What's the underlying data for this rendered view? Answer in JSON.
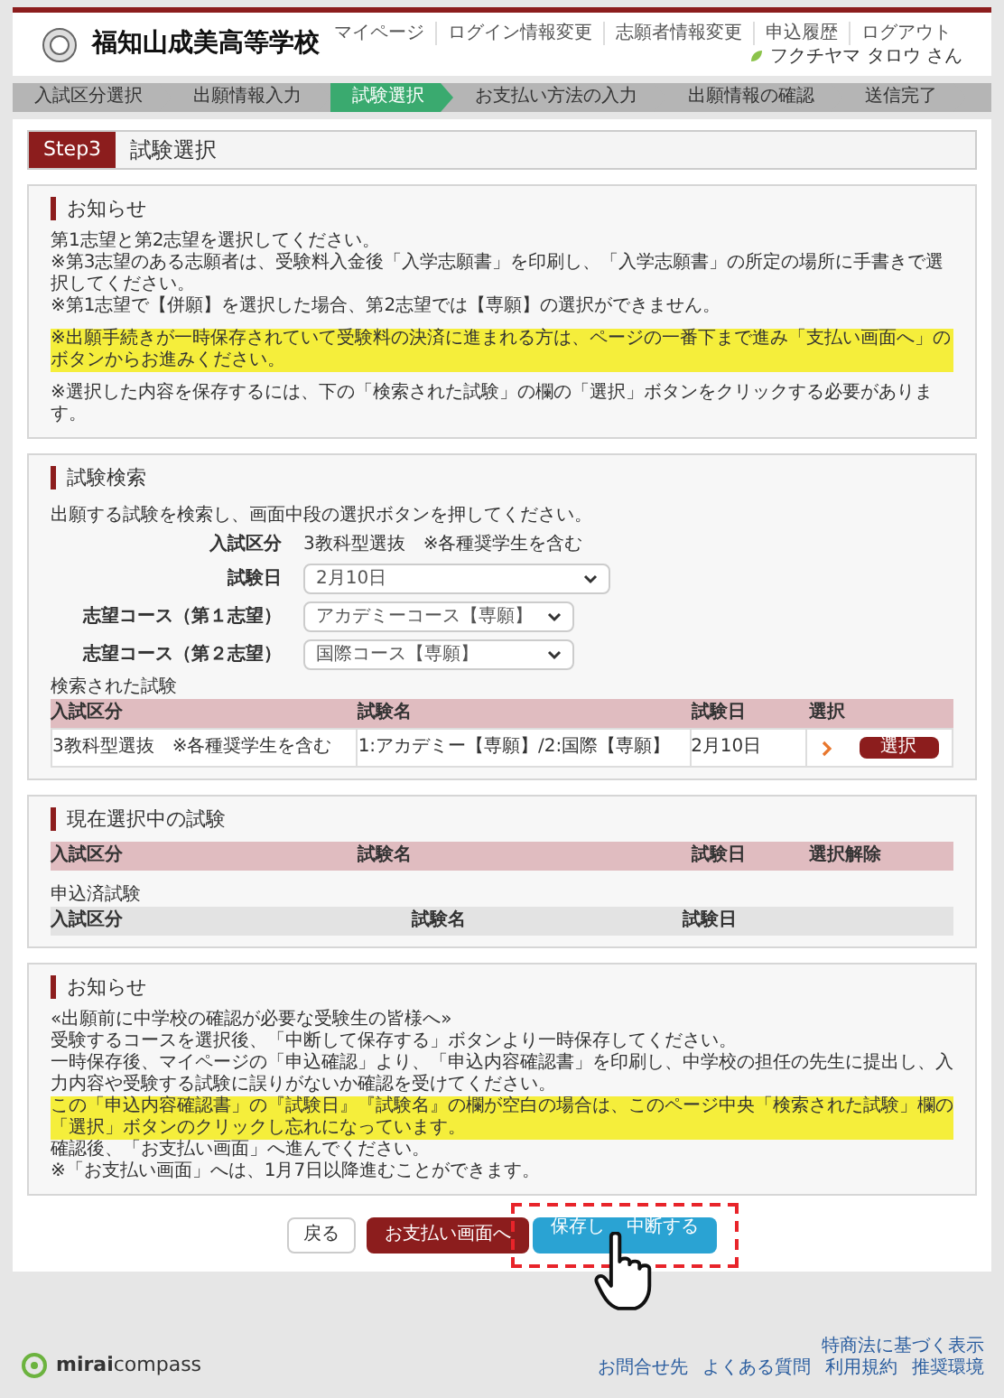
{
  "header": {
    "school_name": "福知山成美高等学校",
    "nav": [
      "マイページ",
      "ログイン情報変更",
      "志願者情報変更",
      "申込履歴",
      "ログアウト"
    ],
    "user": "フクチヤマ タロウ さん"
  },
  "steps": [
    {
      "label": "入試区分選択",
      "selected": false
    },
    {
      "label": "出願情報入力",
      "selected": false
    },
    {
      "label": "試験選択",
      "selected": true
    },
    {
      "label": "お支払い方法の入力",
      "selected": false
    },
    {
      "label": "出願情報の確認",
      "selected": false
    },
    {
      "label": "送信完了",
      "selected": false
    }
  ],
  "page_title": {
    "step": "Step3",
    "title": "試験選択"
  },
  "notice_1": {
    "title": "お知らせ",
    "lines": [
      {
        "text": "第1志望と第2志望を選択してください。",
        "highlight": false,
        "gap_before": false
      },
      {
        "text": "※第3志望のある志願者は、受験料入金後「入学志願書」を印刷し、「入学志願書」の所定の場所に手書きで選択してください。",
        "highlight": false,
        "gap_before": false
      },
      {
        "text": "※第1志望で【併願】を選択した場合、第2志望では【専願】の選択ができません。",
        "highlight": false,
        "gap_before": false
      },
      {
        "text": "※出願手続きが一時保存されていて受験料の決済に進まれる方は、ページの一番下まで進み「支払い画面へ」のボタンからお進みください。",
        "highlight": true,
        "gap_before": true
      },
      {
        "text": "※選択した内容を保存するには、下の「検索された試験」の欄の「選択」ボタンをクリックする必要があります。",
        "highlight": false,
        "gap_before": true
      }
    ]
  },
  "search": {
    "title": "試験検索",
    "intro": "出願する試験を検索し、画面中段の選択ボタンを押してください。",
    "fields": [
      {
        "kind": "text",
        "label": "入試区分",
        "value": "3教科型選抜　※各種奨学生を含む"
      },
      {
        "kind": "select",
        "label": "試験日",
        "value": "2月10日"
      },
      {
        "kind": "select",
        "label": "志望コース（第１志望）",
        "value": "アカデミーコース【専願】"
      },
      {
        "kind": "select",
        "label": "志望コース（第２志望）",
        "value": "国際コース【専願】"
      }
    ],
    "results_title": "検索された試験",
    "columns": [
      "入試区分",
      "試験名",
      "試験日",
      "選択"
    ],
    "rows": [
      {
        "cells": [
          "3教科型選抜　※各種奨学生を含む",
          "1:アカデミー【専願】/2:国際【専願】",
          "2月10日"
        ],
        "button": "選択"
      }
    ]
  },
  "current": {
    "title": "現在選択中の試験",
    "columns": [
      "入試区分",
      "試験名",
      "試験日",
      "選択解除"
    ],
    "applied_title": "申込済試験",
    "applied_columns": [
      "入試区分",
      "試験名",
      "試験日"
    ]
  },
  "notice_2": {
    "title": "お知らせ",
    "lines": [
      {
        "text": "«出願前に中学校の確認が必要な受験生の皆様へ»",
        "highlight": false
      },
      {
        "text": "受験するコースを選択後、「中断して保存する」ボタンより一時保存してください。",
        "highlight": false
      },
      {
        "text": "一時保存後、マイページの「申込確認」より、「申込内容確認書」を印刷し、中学校の担任の先生に提出し、入力内容や受験する試験に誤りがないか確認を受けてください。",
        "highlight": false
      },
      {
        "text": "この「申込内容確認書」の『試験日』『試験名』の欄が空白の場合は、このページ中央「検索された試験」欄の「選択」ボタンのクリックし忘れになっています。",
        "highlight": true
      },
      {
        "text": "確認後、「お支払い画面」へ進んでください。",
        "highlight": false
      },
      {
        "text": "※「お支払い画面」へは、1月7日以降進むことができます。",
        "highlight": false
      }
    ]
  },
  "buttons": [
    {
      "kind": "back",
      "label": "戻る"
    },
    {
      "kind": "pay",
      "label": "お支払い画面へ"
    },
    {
      "kind": "save",
      "label_parts": [
        "保存し",
        "中断する"
      ]
    }
  ],
  "footer": {
    "brand_bold": "mirai",
    "brand": "compass",
    "links_top": [
      "特商法に基づく表示"
    ],
    "links": [
      "お問合せ先",
      "よくある質問",
      "利用規約",
      "推奨環境"
    ]
  }
}
